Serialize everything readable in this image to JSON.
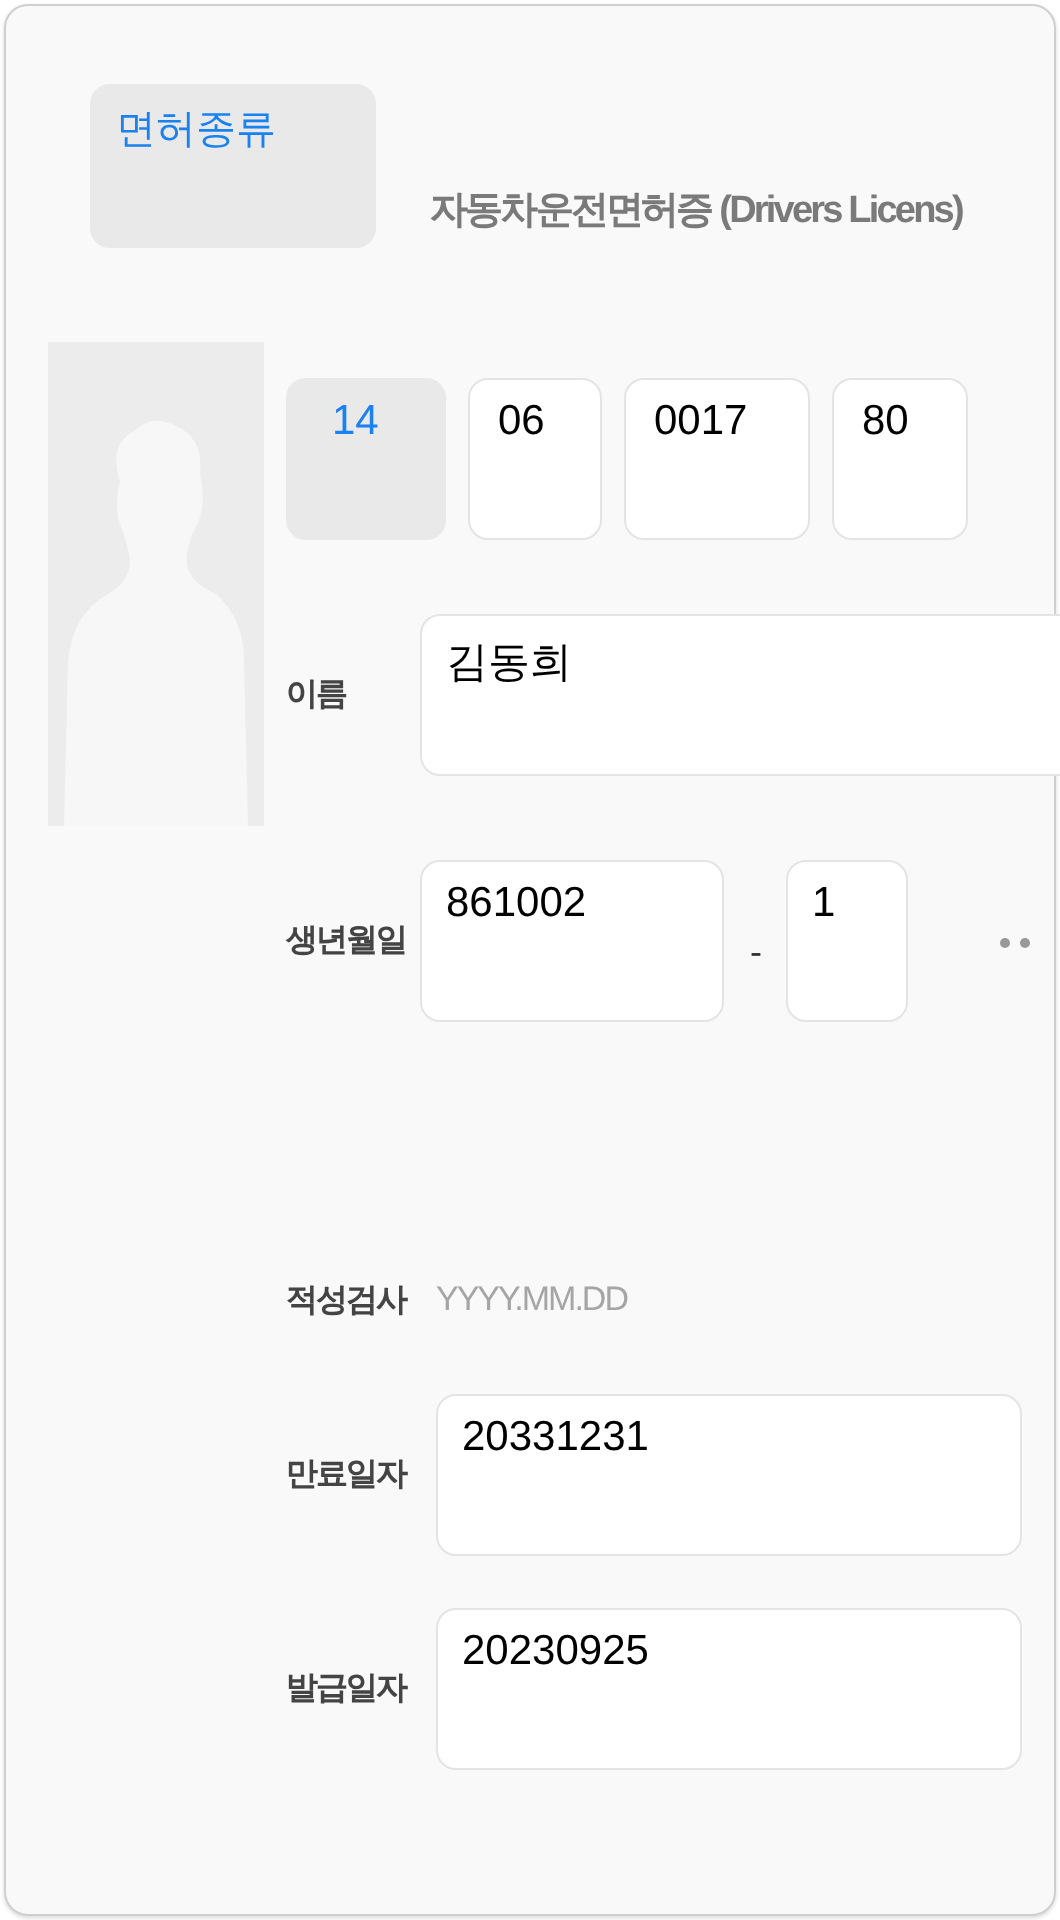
{
  "license_type": {
    "label": "면허종류",
    "kind": "select"
  },
  "title": "자동차운전면허증 (Drivers Licens)",
  "license_number": [
    {
      "value": "14",
      "kind": "select"
    },
    {
      "value": "06",
      "kind": "input"
    },
    {
      "value": "0017",
      "kind": "input"
    },
    {
      "value": "80",
      "kind": "input"
    }
  ],
  "name": {
    "label": "이름",
    "value": "김동희"
  },
  "birth": {
    "label": "생년월일",
    "front": "861002",
    "separator": "-",
    "back": "1",
    "masked": true
  },
  "aptitude_test": {
    "label": "적성검사",
    "placeholder": "YYYY.MM.DD"
  },
  "expiry": {
    "label": "만료일자",
    "value": "20331231"
  },
  "issue": {
    "label": "발급일자",
    "value": "20230925"
  }
}
